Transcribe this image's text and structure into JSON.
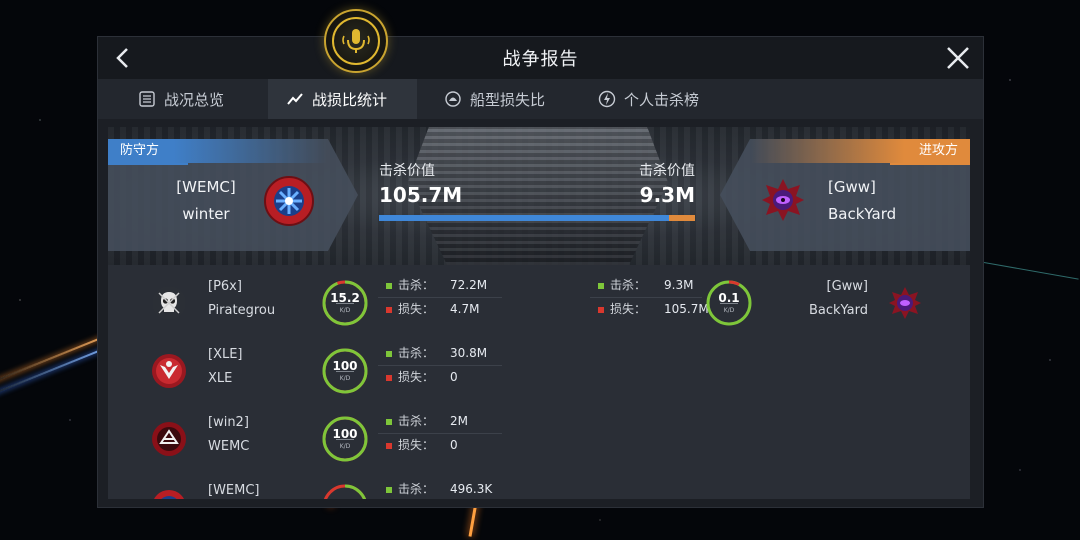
{
  "header": {
    "title": "战争报告"
  },
  "tabs": [
    {
      "label": "战况总览",
      "icon": "list-icon",
      "active": false
    },
    {
      "label": "战损比统计",
      "icon": "trend-icon",
      "active": true
    },
    {
      "label": "船型损失比",
      "icon": "ship-icon",
      "active": false
    },
    {
      "label": "个人击杀榜",
      "icon": "bolt-icon",
      "active": false
    }
  ],
  "summary": {
    "defender": {
      "tag": "防守方",
      "alliance": "[WEMC]",
      "name": "winter",
      "color": "#3f7fc8"
    },
    "attacker": {
      "tag": "进攻方",
      "alliance": "[Gww]",
      "name": "BackYard",
      "color": "#e08a3c"
    },
    "kill_value_label_left": "击杀价值",
    "kill_value_left": "105.7M",
    "kill_value_label_right": "击杀价值",
    "kill_value_right": "9.3M",
    "defender_share": 0.919
  },
  "labels": {
    "kill": "击杀：",
    "loss": "损失：",
    "kd": "K/D"
  },
  "defender_rows": [
    {
      "alliance": "[P6x]",
      "name": "Pirategrou",
      "kd": "15.2",
      "kd_ratio": 0.94,
      "kill": "72.2M",
      "loss": "4.7M",
      "icon": "skull-icon"
    },
    {
      "alliance": "[XLE]",
      "name": "XLE",
      "kd": "100",
      "kd_ratio": 1.0,
      "kill": "30.8M",
      "loss": "0",
      "icon": "xle-emblem-icon"
    },
    {
      "alliance": "[win2]",
      "name": "WEMC",
      "kd": "100",
      "kd_ratio": 1.0,
      "kill": "2M",
      "loss": "0",
      "icon": "win2-emblem-icon"
    },
    {
      "alliance": "[WEMC]",
      "name": "",
      "kd": "",
      "kd_ratio": 0.5,
      "kill": "496.3K",
      "loss": "",
      "icon": "wemc-emblem-icon"
    }
  ],
  "attacker_rows": [
    {
      "alliance": "[Gww]",
      "name": "BackYard",
      "kd": "0.1",
      "kd_ratio": 0.08,
      "kill": "9.3M",
      "loss": "105.7M",
      "icon": "gww-emblem-icon"
    }
  ],
  "colors": {
    "good": "#7ec63a",
    "bad": "#d9382e",
    "accent_gold": "#e0b830"
  }
}
